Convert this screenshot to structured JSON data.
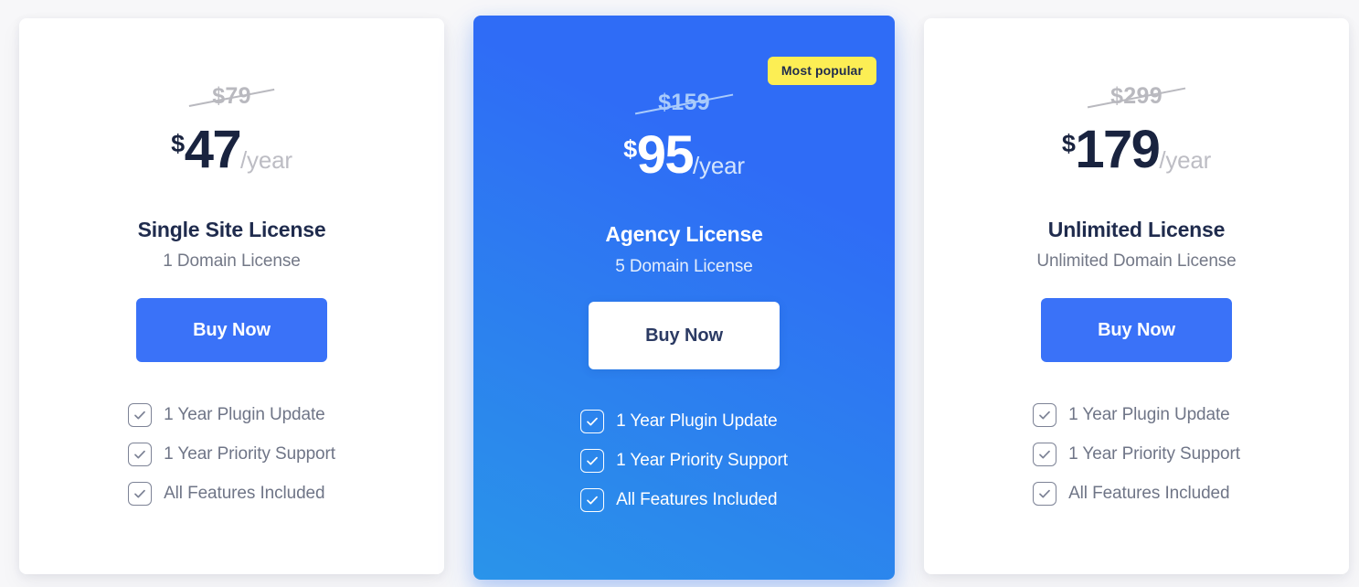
{
  "plans": [
    {
      "id": "single-site",
      "old_price": "$79",
      "currency": "$",
      "amount": "47",
      "period": "/year",
      "title": "Single Site License",
      "subtitle": "1 Domain License",
      "cta": "Buy Now",
      "badge": null,
      "features": [
        "1 Year Plugin Update",
        "1 Year Priority Support",
        "All Features Included"
      ]
    },
    {
      "id": "agency",
      "old_price": "$159",
      "currency": "$",
      "amount": "95",
      "period": "/year",
      "title": "Agency License",
      "subtitle": "5 Domain License",
      "cta": "Buy Now",
      "badge": "Most popular",
      "features": [
        "1 Year Plugin Update",
        "1 Year Priority Support",
        "All Features Included"
      ]
    },
    {
      "id": "unlimited",
      "old_price": "$299",
      "currency": "$",
      "amount": "179",
      "period": "/year",
      "title": "Unlimited License",
      "subtitle": "Unlimited Domain License",
      "cta": "Buy Now",
      "badge": null,
      "features": [
        "1 Year Plugin Update",
        "1 Year Priority Support",
        "All Features Included"
      ]
    }
  ],
  "icons": {
    "checkbox": "checkbox-checked-icon"
  },
  "colors": {
    "page_background": "#f7f7f9",
    "card_background": "#ffffff",
    "featured_gradient_start": "#2f6cf6",
    "featured_gradient_end": "#2a94ea",
    "button_blue": "#3a72f8",
    "badge_yellow": "#fcee54",
    "title_navy": "#1f2b4d",
    "price_navy": "#19233f",
    "muted_gray": "#737887",
    "old_price_gray": "#b9b9bf"
  }
}
